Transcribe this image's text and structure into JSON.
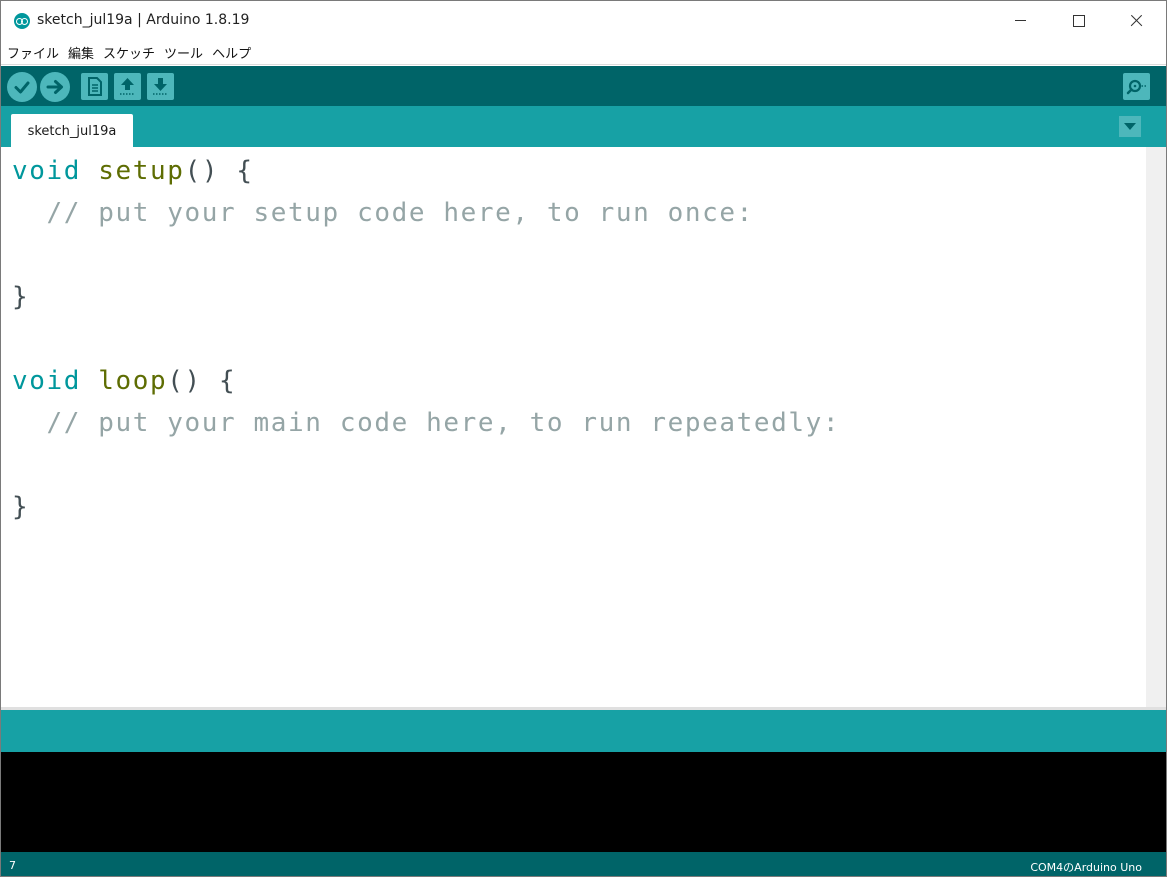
{
  "window": {
    "title": "sketch_jul19a | Arduino 1.8.19"
  },
  "menubar": {
    "items": [
      "ファイル",
      "編集",
      "スケッチ",
      "ツール",
      "ヘルプ"
    ]
  },
  "toolbar": {
    "buttons": [
      {
        "name": "verify",
        "icon": "check-icon"
      },
      {
        "name": "upload",
        "icon": "arrow-right-icon"
      },
      {
        "name": "new",
        "icon": "document-icon"
      },
      {
        "name": "open",
        "icon": "arrow-up-icon"
      },
      {
        "name": "save",
        "icon": "arrow-down-icon"
      },
      {
        "name": "serial-monitor",
        "icon": "magnifier-icon"
      }
    ]
  },
  "tabs": {
    "active": "sketch_jul19a",
    "menu_icon": "triangle-down-icon"
  },
  "editor": {
    "lines": [
      {
        "tokens": [
          {
            "t": "void",
            "c": "kw"
          },
          {
            "t": " ",
            "c": "pl"
          },
          {
            "t": "setup",
            "c": "fn"
          },
          {
            "t": "() {",
            "c": "pl"
          }
        ]
      },
      {
        "tokens": [
          {
            "t": "  // put your setup code here, to run once:",
            "c": "cm"
          }
        ]
      },
      {
        "tokens": []
      },
      {
        "tokens": [
          {
            "t": "}",
            "c": "pl"
          }
        ]
      },
      {
        "tokens": []
      },
      {
        "tokens": [
          {
            "t": "void",
            "c": "kw"
          },
          {
            "t": " ",
            "c": "pl"
          },
          {
            "t": "loop",
            "c": "fn"
          },
          {
            "t": "() {",
            "c": "pl"
          }
        ]
      },
      {
        "tokens": [
          {
            "t": "  // put your main code here, to run repeatedly:",
            "c": "cm"
          }
        ]
      },
      {
        "tokens": []
      },
      {
        "tokens": [
          {
            "t": "}",
            "c": "pl"
          }
        ]
      }
    ]
  },
  "footer": {
    "line_number": "7",
    "board": "COM4のArduino Uno"
  },
  "colors": {
    "toolbar": "#006468",
    "tabstrip": "#17a1a5",
    "button": "#4db7bb",
    "keyword": "#00979c",
    "function": "#5e6d03",
    "comment": "#95a5a6",
    "console": "#000000"
  }
}
